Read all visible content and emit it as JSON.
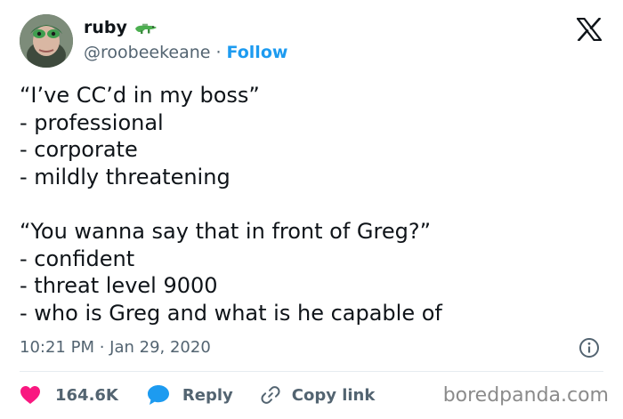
{
  "author": {
    "name": "ruby",
    "handle": "@roobeekeane",
    "separator": "·",
    "follow_label": "Follow",
    "name_emoji_icon": "crocodile-icon"
  },
  "platform_icon": "x-logo-icon",
  "tweet": {
    "lines": [
      "“I’ve CC’d in my boss”",
      "- professional",
      "- corporate",
      "- mildly threatening",
      "",
      "“You wanna say that in front of Greg?”",
      "- confident",
      "- threat level 9000",
      "- who is Greg and what is he capable of"
    ]
  },
  "meta": {
    "timestamp": "10:21 PM · Jan 29, 2020",
    "info_icon": "info-icon"
  },
  "actions": {
    "likes_count": "164.6K",
    "reply_label": "Reply",
    "copy_link_label": "Copy link"
  },
  "watermark": "boredpanda.com",
  "colors": {
    "text": "#0f1419",
    "secondary": "#536471",
    "link": "#1d9bf0",
    "like": "#f91880",
    "reply": "#1d9bf0",
    "divider": "#e6ecf0"
  }
}
